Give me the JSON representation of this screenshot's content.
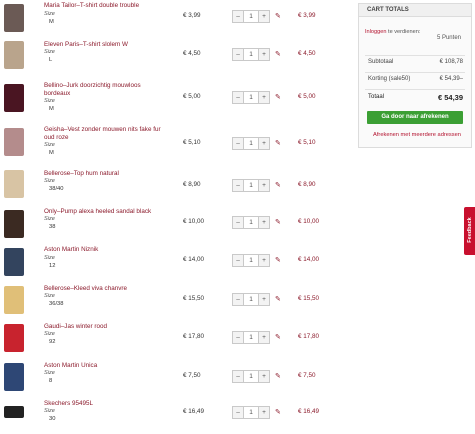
{
  "cart": {
    "size_label": "Size",
    "items": [
      {
        "name": "Maria Tailor–T-shirt double trouble",
        "size": "M",
        "price": "€ 3,99",
        "qty": "1",
        "total": "€ 3,99",
        "color": "#6b5a55"
      },
      {
        "name": "Eleven Paris–T-shirt slolem W",
        "size": "L",
        "price": "€ 4,50",
        "qty": "1",
        "total": "€ 4,50",
        "color": "#b9a48c"
      },
      {
        "name": "Bellino–Jurk doorzichtig mouwloos bordeaux",
        "size": "M",
        "price": "€ 5,00",
        "qty": "1",
        "total": "€ 5,00",
        "color": "#4a1522"
      },
      {
        "name": "Geisha–Vest zonder mouwen nits fake fur oud roze",
        "size": "M",
        "price": "€ 5,10",
        "qty": "1",
        "total": "€ 5,10",
        "color": "#b48c8c"
      },
      {
        "name": "Bellerose–Top hum natural",
        "size": "38/40",
        "price": "€ 8,90",
        "qty": "1",
        "total": "€ 8,90",
        "color": "#d8c4a4"
      },
      {
        "name": "Only–Pump alexa heeled sandal black",
        "size": "38",
        "price": "€ 10,00",
        "qty": "1",
        "total": "€ 10,00",
        "color": "#3b2a22"
      },
      {
        "name": "Aston Martin Niznik",
        "size": "12",
        "price": "€ 14,00",
        "qty": "1",
        "total": "€ 14,00",
        "color": "#33445e"
      },
      {
        "name": "Bellerose–Kleed viva chanvre",
        "size": "36/38",
        "price": "€ 15,50",
        "qty": "1",
        "total": "€ 15,50",
        "color": "#e0bf78"
      },
      {
        "name": "Gaudi–Jas winter rood",
        "size": "92",
        "price": "€ 17,80",
        "qty": "1",
        "total": "€ 17,80",
        "color": "#c8232e"
      },
      {
        "name": "Aston Martin Unica",
        "size": "8",
        "price": "€ 7,50",
        "qty": "1",
        "total": "€ 7,50",
        "color": "#2e4775"
      },
      {
        "name": "Skechers 95495L",
        "size": "30",
        "price": "€ 16,49",
        "qty": "1",
        "total": "€ 16,49",
        "color": "#222222"
      }
    ]
  },
  "totals": {
    "heading": "CART TOTALS",
    "login_link": "Inloggen",
    "login_text": "te verdienen:",
    "points": "5 Punten",
    "subtotal_label": "Subtotaal",
    "subtotal_value": "€ 108,78",
    "discount_label": "Korting (sale50)",
    "discount_value": "€ 54,39–",
    "total_label": "Totaal",
    "total_value": "€ 54,39",
    "checkout_button": "Ga door naar afrekenen",
    "multi_address_link": "Afrekenen met meerdere adressen"
  },
  "feedback": {
    "label": "Feedback"
  },
  "colors": {
    "accent": "#8b1a2b",
    "link": "#b3122e",
    "checkout": "#3b9f34",
    "feedback": "#c8102e"
  }
}
